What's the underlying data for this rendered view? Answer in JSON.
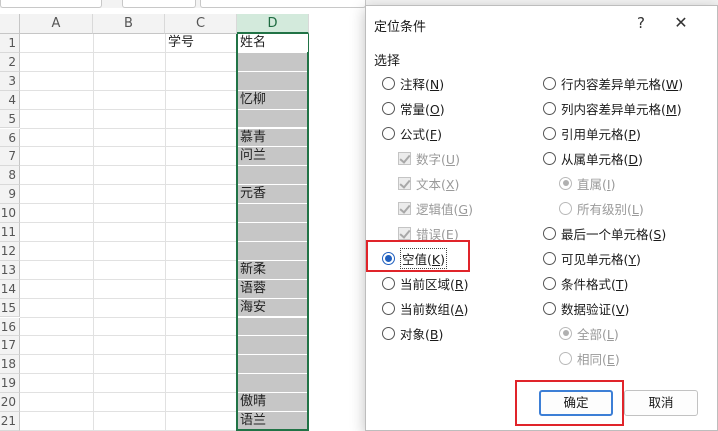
{
  "sheet": {
    "columns": [
      "A",
      "B",
      "C",
      "D"
    ],
    "selected_column": "D",
    "rows": [
      "1",
      "2",
      "3",
      "4",
      "5",
      "6",
      "7",
      "8",
      "9",
      "10",
      "11",
      "12",
      "13",
      "14",
      "15",
      "16",
      "17",
      "18",
      "19",
      "20",
      "21"
    ],
    "header_c": "学号",
    "header_d": "姓名",
    "names": [
      {
        "row": "4",
        "text": "忆柳"
      },
      {
        "row": "6",
        "text": "慕青"
      },
      {
        "row": "7",
        "text": "问兰"
      },
      {
        "row": "9",
        "text": "元香"
      },
      {
        "row": "13",
        "text": "新柔"
      },
      {
        "row": "14",
        "text": "语蓉"
      },
      {
        "row": "15",
        "text": "海安"
      },
      {
        "row": "20",
        "text": "傲晴"
      },
      {
        "row": "21",
        "text": "语兰"
      }
    ]
  },
  "dialog": {
    "title": "定位条件",
    "help": "?",
    "close": "✕",
    "group_label": "选择",
    "left_options": [
      {
        "label": "注释",
        "key": "N"
      },
      {
        "label": "常量",
        "key": "O"
      },
      {
        "label": "公式",
        "key": "F"
      },
      {
        "label": "数字",
        "key": "U"
      },
      {
        "label": "文本",
        "key": "X"
      },
      {
        "label": "逻辑值",
        "key": "G"
      },
      {
        "label": "错误",
        "key": "E"
      },
      {
        "label": "空值",
        "key": "K"
      },
      {
        "label": "当前区域",
        "key": "R"
      },
      {
        "label": "当前数组",
        "key": "A"
      },
      {
        "label": "对象",
        "key": "B"
      }
    ],
    "right_options": [
      {
        "label": "行内容差异单元格",
        "key": "W"
      },
      {
        "label": "列内容差异单元格",
        "key": "M"
      },
      {
        "label": "引用单元格",
        "key": "P"
      },
      {
        "label": "从属单元格",
        "key": "D"
      },
      {
        "label": "直属",
        "key": "I"
      },
      {
        "label": "所有级别",
        "key": "L"
      },
      {
        "label": "最后一个单元格",
        "key": "S"
      },
      {
        "label": "可见单元格",
        "key": "Y"
      },
      {
        "label": "条件格式",
        "key": "T"
      },
      {
        "label": "数据验证",
        "key": "V"
      },
      {
        "label": "全部",
        "key": "L"
      },
      {
        "label": "相同",
        "key": "E"
      }
    ],
    "ok_label": "确定",
    "cancel_label": "取消",
    "colors": {
      "accent": "#1f5fbf",
      "highlight": "#e0242a",
      "selection": "#217346"
    }
  }
}
